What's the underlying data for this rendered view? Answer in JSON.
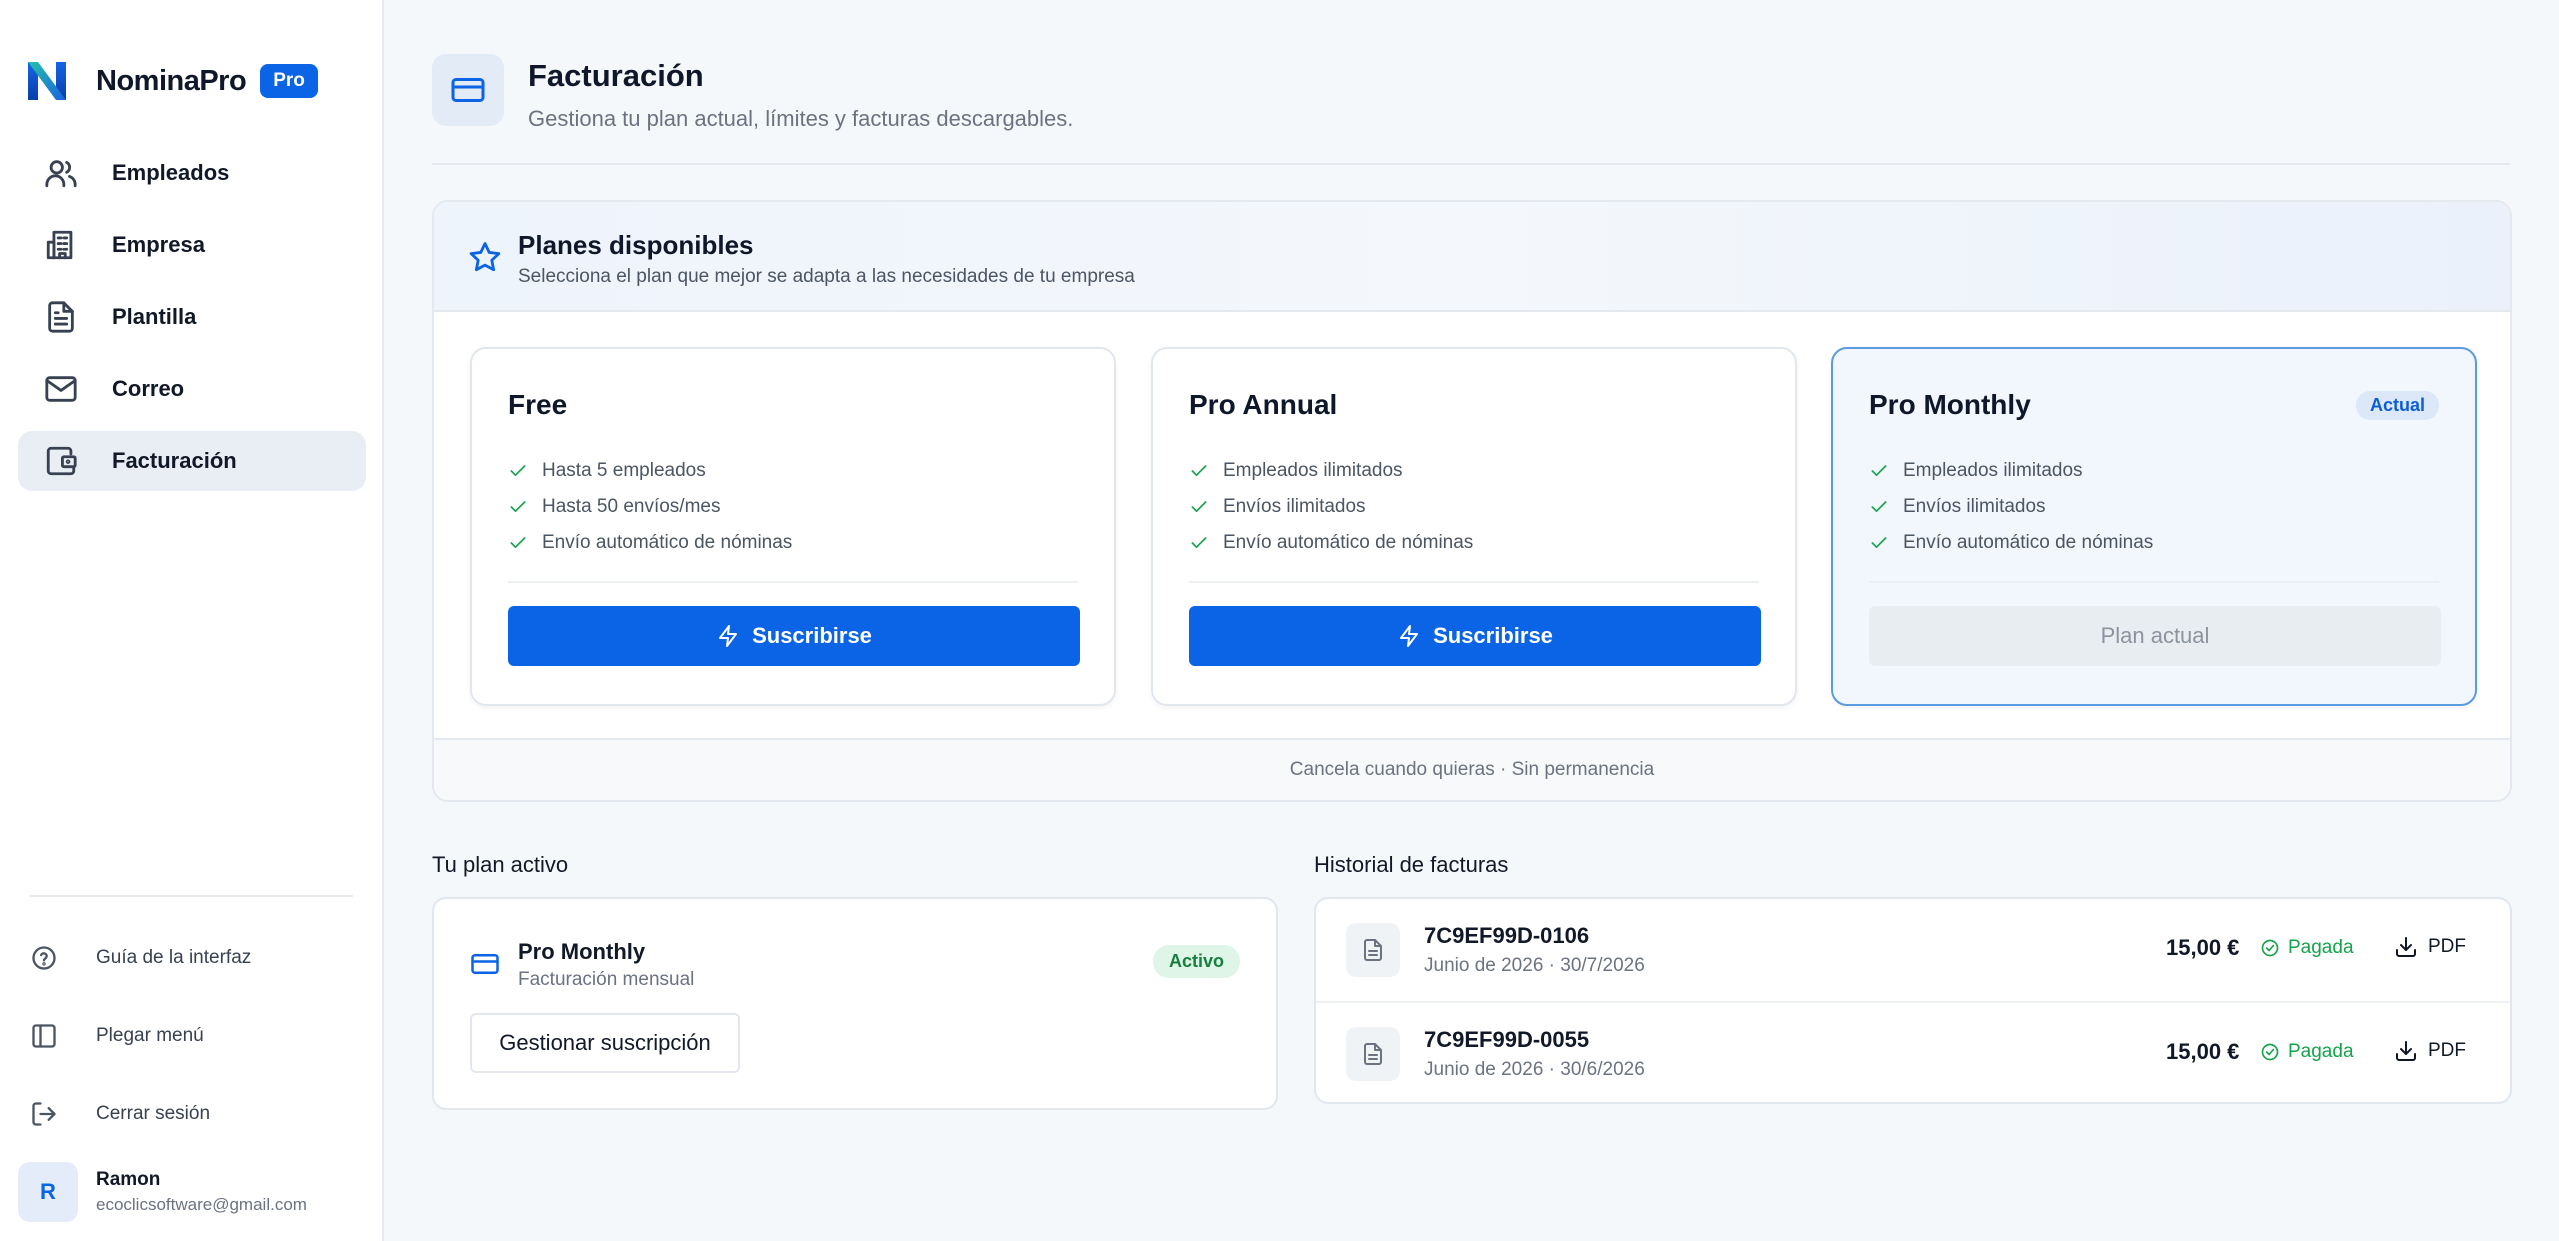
{
  "app": {
    "name": "NominaPro",
    "badge": "Pro"
  },
  "nav": {
    "items": [
      {
        "label": "Empleados",
        "icon": "users-icon"
      },
      {
        "label": "Empresa",
        "icon": "building-icon"
      },
      {
        "label": "Plantilla",
        "icon": "file-text-icon"
      },
      {
        "label": "Correo",
        "icon": "mail-icon"
      },
      {
        "label": "Facturación",
        "icon": "wallet-icon",
        "active": true
      }
    ]
  },
  "sidebar_bottom": {
    "guide": "Guía de la interfaz",
    "collapse": "Plegar menú",
    "logout": "Cerrar sesión"
  },
  "user": {
    "initial": "R",
    "name": "Ramon",
    "email": "ecoclicsoftware@gmail.com"
  },
  "header": {
    "title": "Facturación",
    "subtitle": "Gestiona tu plan actual, límites y facturas descargables."
  },
  "plans": {
    "title": "Planes disponibles",
    "subtitle": "Selecciona el plan que mejor se adapta a las necesidades de tu empresa",
    "footer": "Cancela cuando quieras · Sin permanencia",
    "cards": [
      {
        "name": "Free",
        "features": [
          "Hasta 5 empleados",
          "Hasta 50 envíos/mes",
          "Envío automático de nóminas"
        ],
        "button": "Suscribirse"
      },
      {
        "name": "Pro Annual",
        "features": [
          "Empleados ilimitados",
          "Envíos ilimitados",
          "Envío automático de nóminas"
        ],
        "button": "Suscribirse"
      },
      {
        "name": "Pro Monthly",
        "badge": "Actual",
        "features": [
          "Empleados ilimitados",
          "Envíos ilimitados",
          "Envío automático de nóminas"
        ],
        "button": "Plan actual"
      }
    ]
  },
  "active_plan": {
    "section_title": "Tu plan activo",
    "name": "Pro Monthly",
    "billing": "Facturación mensual",
    "status": "Activo",
    "manage_button": "Gestionar suscripción"
  },
  "invoices": {
    "section_title": "Historial de facturas",
    "rows": [
      {
        "id": "7C9EF99D-0106",
        "period": "Junio de 2026 · 30/7/2026",
        "amount": "15,00 €",
        "status": "Pagada",
        "download": "PDF"
      },
      {
        "id": "7C9EF99D-0055",
        "period": "Junio de 2026 · 30/6/2026",
        "amount": "15,00 €",
        "status": "Pagada",
        "download": "PDF"
      }
    ]
  },
  "colors": {
    "accent": "#0b63e5",
    "success": "#16a34a",
    "sidebar_active": "#e9eef4",
    "background": "#f5f8fa"
  }
}
